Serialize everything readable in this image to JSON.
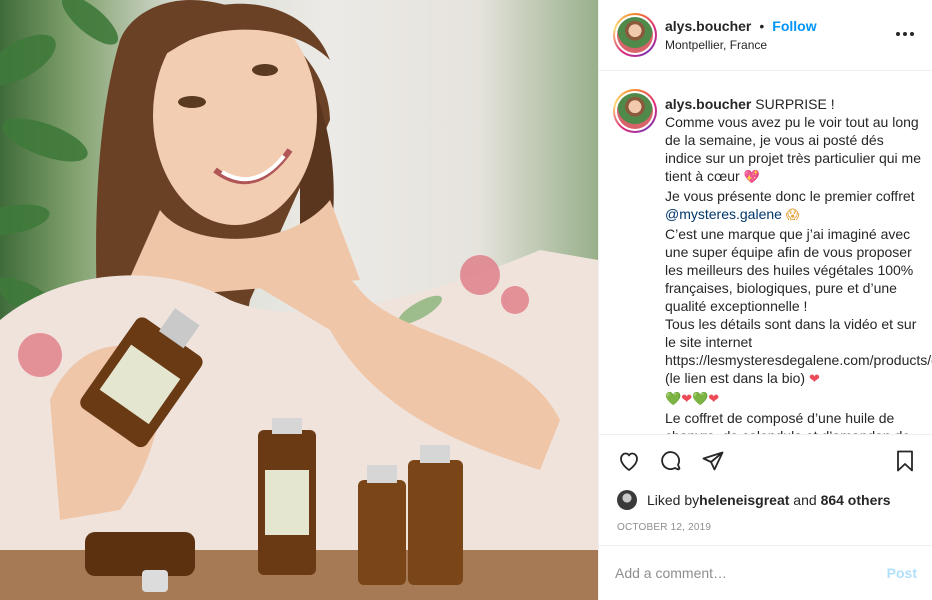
{
  "post": {
    "username": "alys.boucher",
    "follow_label": "Follow",
    "dot": "•",
    "location": "Montpellier, France"
  },
  "caption": {
    "username": "alys.boucher",
    "lines": {
      "l1": " SURPRISE !",
      "l2": "Comme vous avez pu le voir tout au long de la semaine, je vous ai posté dés indice sur un projet très particulier qui me tient à cœur ",
      "emoji_heart": "💖",
      "l3": "Je vous présente donc le premier coffret ",
      "mention": "@mysteres.galene",
      "emoji_scream": "😱",
      "l4": "C’est une marque que j’ai imaginé avec une super équipe afin de vous proposer les meilleurs des huiles végétales 100% françaises, biologiques, pure et d’une qualité exceptionnelle !",
      "l5": "Tous les détails sont dans la vidéo et sur le site internet https://lesmysteresdegalene.com/products/coffret (le lien est dans la bio) ",
      "heart_red": "❤",
      "hearts_row": [
        "💚",
        "❤",
        "💚",
        "❤"
      ],
      "l6": "Le coffret de composé d’une huile de chanvre, de calendula et d’amandon de"
    }
  },
  "likes": {
    "prefix": "Liked by ",
    "user": "heleneisgreat",
    "and": " and ",
    "count": "864 others"
  },
  "date": "OCTOBER 12, 2019",
  "comment_box": {
    "placeholder": "Add a comment…",
    "post_label": "Post"
  },
  "icons": {
    "like": "heart-outline-icon",
    "comment": "comment-bubble-icon",
    "share": "paper-plane-icon",
    "save": "bookmark-icon",
    "more": "ellipsis-icon"
  },
  "colors": {
    "accent": "#0095f6",
    "post_disabled": "#b2dffc",
    "muted": "#8e8e8e",
    "mention": "#00376b"
  }
}
